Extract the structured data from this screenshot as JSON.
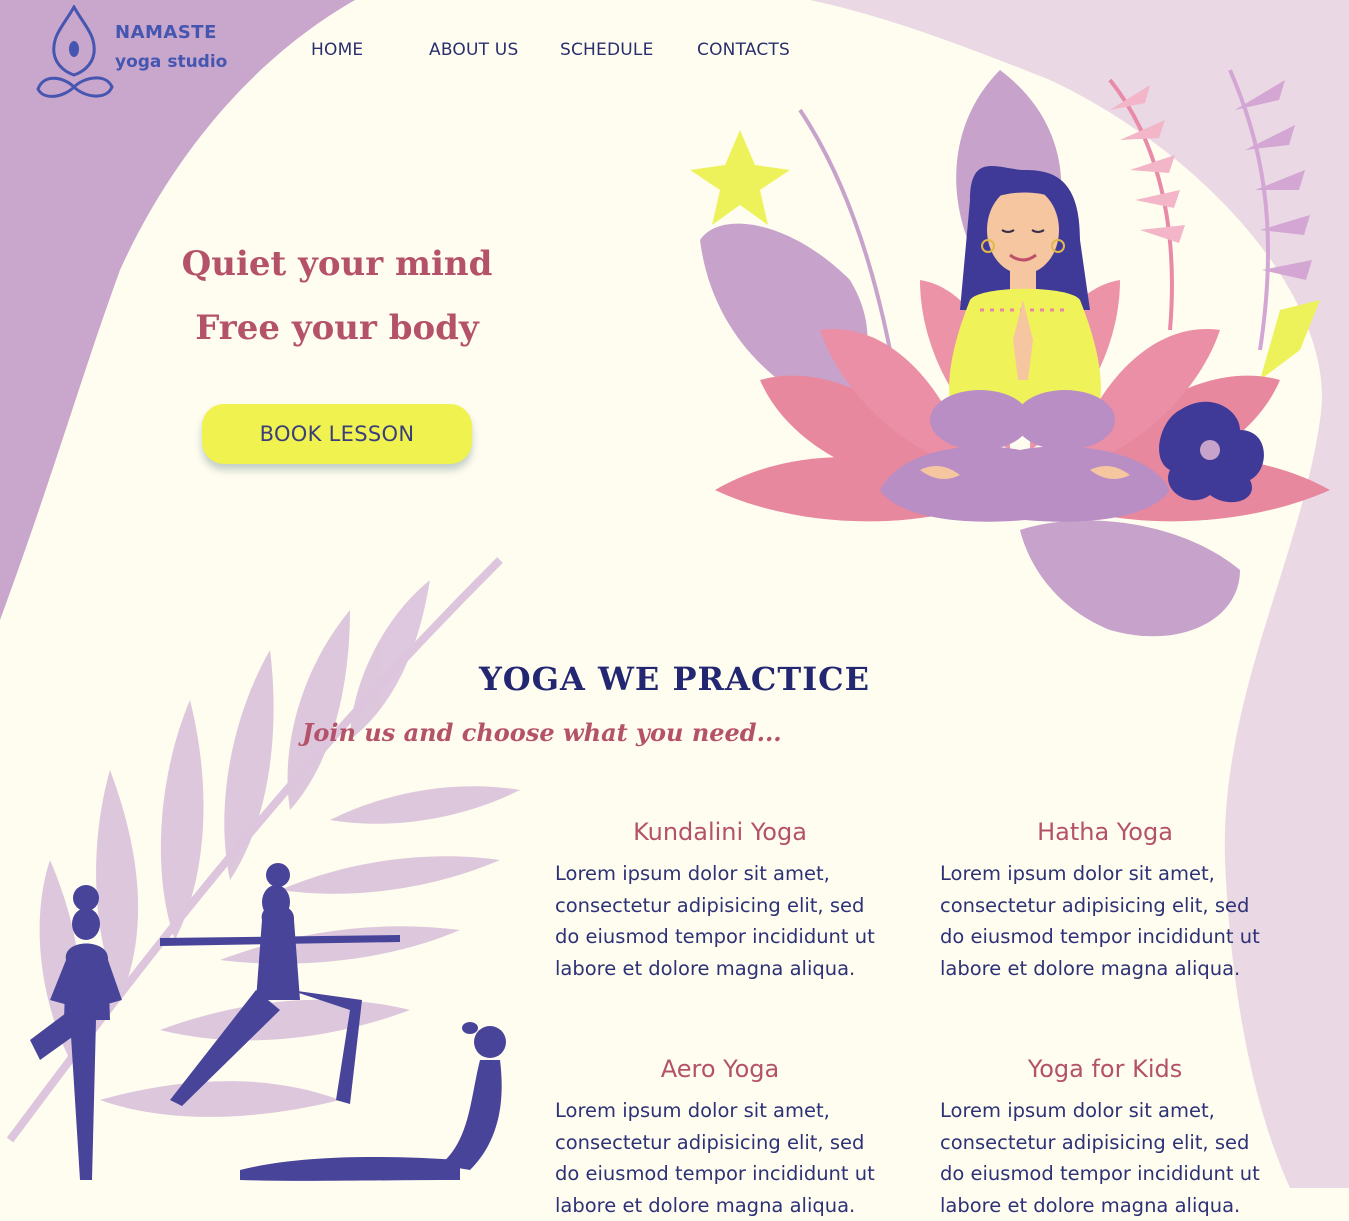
{
  "brand": {
    "name": "NAMASTE",
    "tagline": "yoga studio"
  },
  "nav": {
    "items": [
      {
        "label": "HOME"
      },
      {
        "label": "ABOUT US"
      },
      {
        "label": "SCHEDULE"
      },
      {
        "label": "CONTACTS"
      }
    ]
  },
  "hero": {
    "line1": "Quiet your mind",
    "line2": "Free your body",
    "cta_label": "BOOK LESSON"
  },
  "practice": {
    "title": "YOGA WE PRACTICE",
    "subtitle": "Join us and choose what you need...",
    "cards": [
      {
        "title": "Kundalini Yoga",
        "text": "Lorem ipsum dolor sit amet, consectetur adipisicing elit, sed do eiusmod tempor incididunt ut labore et dolore magna aliqua."
      },
      {
        "title": "Hatha Yoga",
        "text": "Lorem ipsum dolor sit amet, consectetur adipisicing elit, sed do eiusmod tempor incididunt ut labore et dolore magna aliqua."
      },
      {
        "title": "Aero Yoga",
        "text": "Lorem ipsum dolor sit amet, consectetur adipisicing elit, sed do eiusmod tempor incididunt ut labore et dolore magna aliqua."
      },
      {
        "title": "Yoga for Kids",
        "text": "Lorem ipsum dolor sit amet, consectetur adipisicing elit, sed do eiusmod tempor incididunt ut labore et dolore magna aliqua."
      }
    ]
  },
  "colors": {
    "background": "#fffdf0",
    "lilac": "#c9a6cc",
    "navy": "#232771",
    "rose": "#b4526a",
    "yellow": "#f0f250",
    "silhouette": "#48449a"
  }
}
